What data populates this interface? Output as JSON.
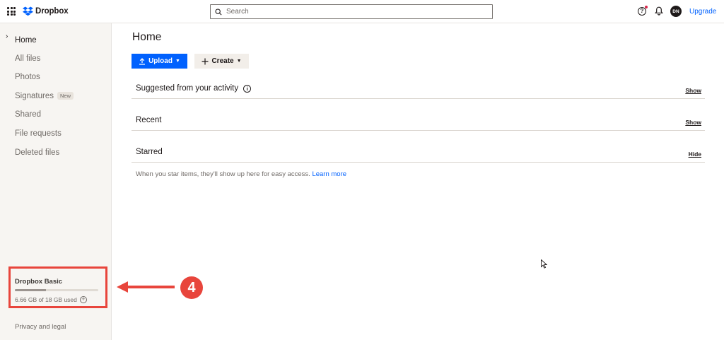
{
  "topbar": {
    "brand": "Dropbox",
    "search_placeholder": "Search",
    "help_glyph": "?",
    "avatar_initials": "DN",
    "upgrade_label": "Upgrade"
  },
  "sidebar": {
    "items": [
      {
        "label": "Home",
        "active": true
      },
      {
        "label": "All files"
      },
      {
        "label": "Photos"
      },
      {
        "label": "Signatures",
        "badge": "New"
      },
      {
        "label": "Shared"
      },
      {
        "label": "File requests"
      },
      {
        "label": "Deleted files"
      }
    ],
    "plan": {
      "name": "Dropbox Basic",
      "usage_text": "6.66 GB of 18 GB used",
      "used_fraction": 0.37
    },
    "footer_link": "Privacy and legal"
  },
  "annotation": {
    "step_number": "4"
  },
  "main": {
    "title": "Home",
    "upload_label": "Upload",
    "create_label": "Create",
    "sections": [
      {
        "title": "Suggested from your activity",
        "action": "Show",
        "has_info": true
      },
      {
        "title": "Recent",
        "action": "Show"
      },
      {
        "title": "Starred",
        "action": "Hide"
      }
    ],
    "starred_note": "When you star items, they'll show up here for easy access.",
    "learn_more": "Learn more"
  },
  "colors": {
    "accent": "#0061fe",
    "annotation": "#e8453c",
    "sidebar_bg": "#f7f5f2"
  }
}
